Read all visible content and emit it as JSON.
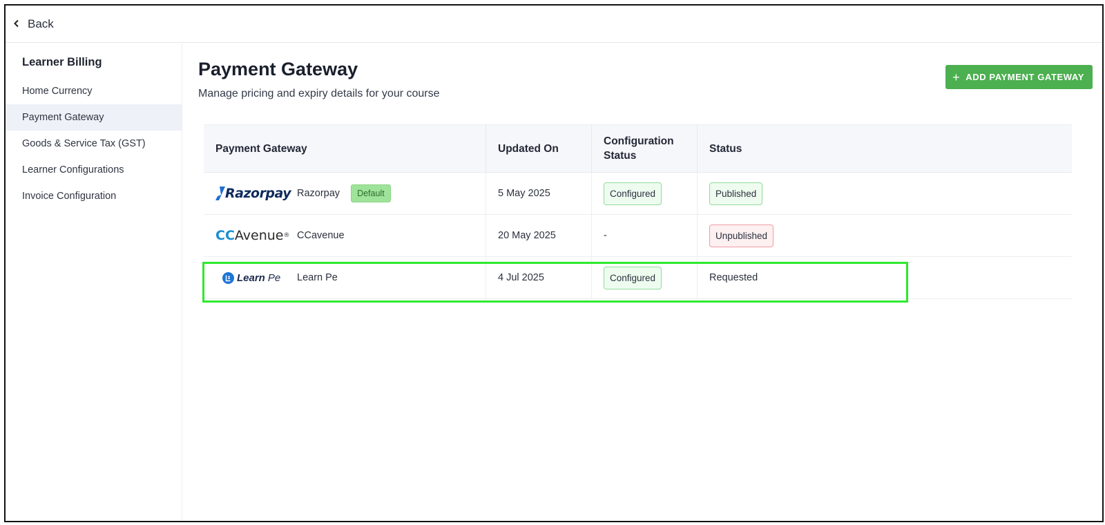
{
  "topbar": {
    "back_label": "Back"
  },
  "sidebar": {
    "title": "Learner Billing",
    "items": [
      {
        "label": "Home Currency"
      },
      {
        "label": "Payment Gateway",
        "active": true
      },
      {
        "label": "Goods & Service Tax (GST)"
      },
      {
        "label": "Learner Configurations"
      },
      {
        "label": "Invoice Configuration"
      }
    ]
  },
  "header": {
    "title": "Payment Gateway",
    "subtitle": "Manage pricing and expiry details for your course",
    "add_button_label": "ADD PAYMENT GATEWAY"
  },
  "table": {
    "columns": [
      "Payment Gateway",
      "Updated On",
      "Configuration Status",
      "Status"
    ],
    "rows": [
      {
        "logo_text": "Razorpay",
        "name": "Razorpay",
        "badge": "Default",
        "updated_on": "5 May 2025",
        "config_status": "Configured",
        "status": "Published"
      },
      {
        "logo_text_a": "CC",
        "logo_text_b": "Avenue",
        "logo_reg": "®",
        "name": "CCavenue",
        "updated_on": "20 May 2025",
        "config_status": "-",
        "status": "Unpublished"
      },
      {
        "logo_text_a": "Learn",
        "logo_text_b": "Pe",
        "name": "Learn Pe",
        "updated_on": "4 Jul 2025",
        "config_status": "Configured",
        "status": "Requested"
      }
    ]
  },
  "colors": {
    "accent_green": "#4caf50",
    "highlight": "#2ee92e",
    "published_border": "#8fdb98",
    "unpublished_border": "#ef9aa2"
  }
}
